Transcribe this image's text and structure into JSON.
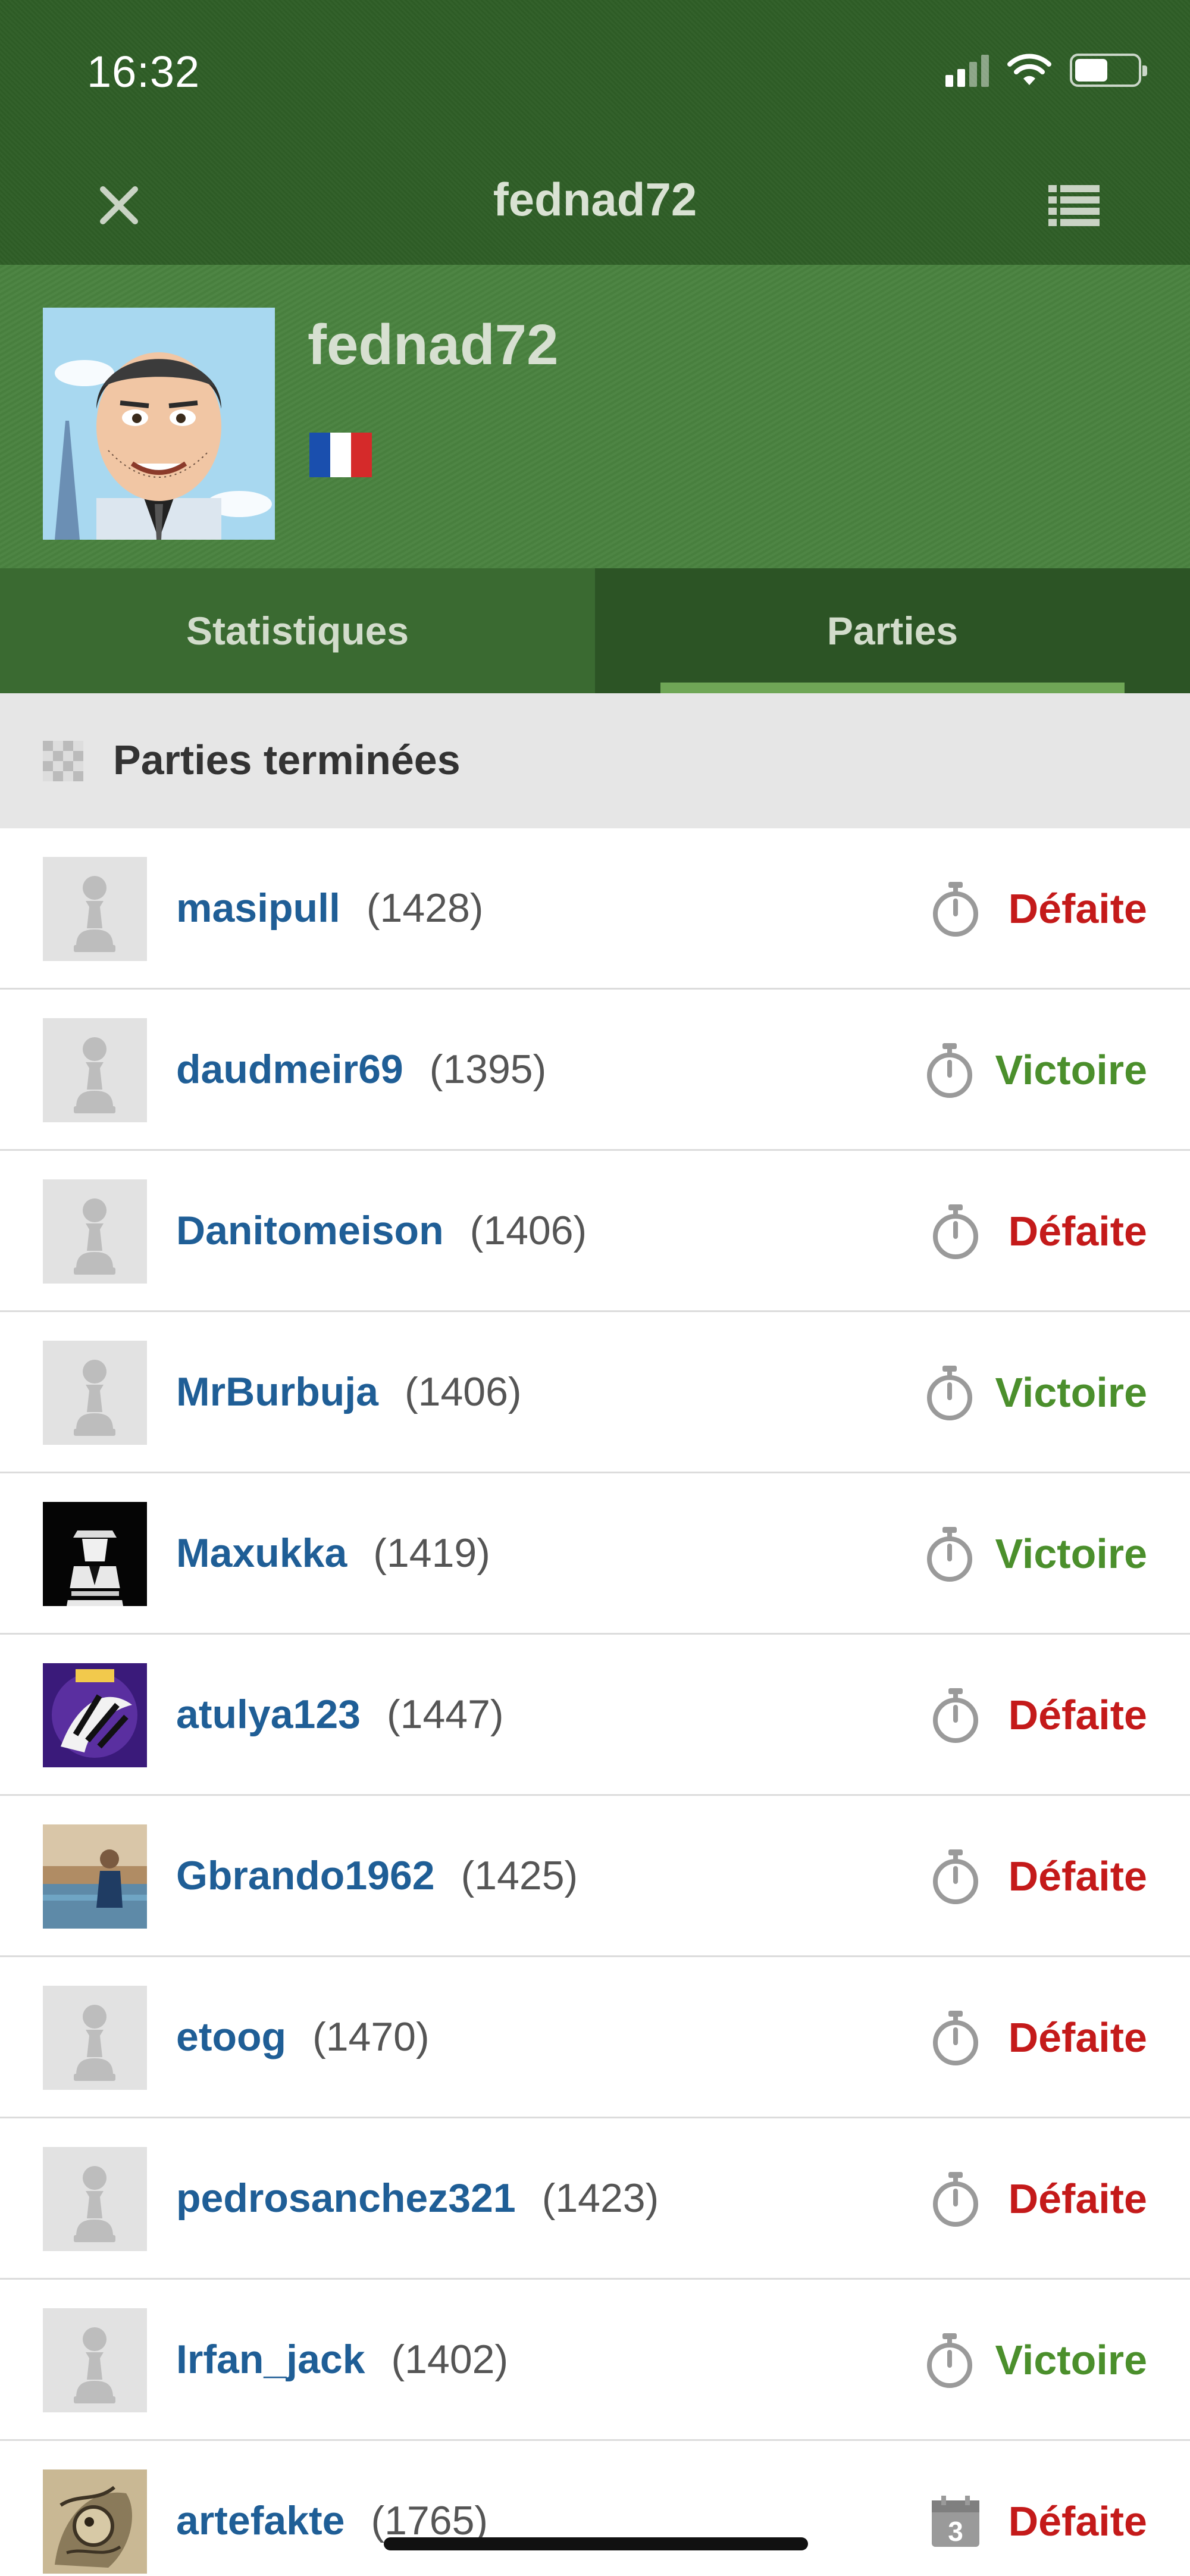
{
  "status_bar": {
    "time": "16:32"
  },
  "nav": {
    "title": "fednad72"
  },
  "profile": {
    "username": "fednad72",
    "country": "France",
    "flag_colors": [
      "#1a4fae",
      "#ffffff",
      "#d52a2a"
    ]
  },
  "tabs": [
    {
      "label": "Statistiques",
      "selected": false
    },
    {
      "label": "Parties",
      "selected": true
    }
  ],
  "section": {
    "title": "Parties terminées"
  },
  "games": [
    {
      "opponent": "masipull",
      "rating": "(1428)",
      "result": "Défaite",
      "outcome": "loss",
      "avatar": "pawn",
      "mode_icon": "stopwatch-icon"
    },
    {
      "opponent": "daudmeir69",
      "rating": "(1395)",
      "result": "Victoire",
      "outcome": "win",
      "avatar": "pawn",
      "mode_icon": "stopwatch-icon"
    },
    {
      "opponent": "Danitomeison",
      "rating": "(1406)",
      "result": "Défaite",
      "outcome": "loss",
      "avatar": "pawn",
      "mode_icon": "stopwatch-icon"
    },
    {
      "opponent": "MrBurbuja",
      "rating": "(1406)",
      "result": "Victoire",
      "outcome": "win",
      "avatar": "pawn",
      "mode_icon": "stopwatch-icon"
    },
    {
      "opponent": "Maxukka",
      "rating": "(1419)",
      "result": "Victoire",
      "outcome": "win",
      "avatar": "godfather",
      "mode_icon": "stopwatch-icon"
    },
    {
      "opponent": "atulya123",
      "rating": "(1447)",
      "result": "Défaite",
      "outcome": "loss",
      "avatar": "purple",
      "mode_icon": "stopwatch-icon"
    },
    {
      "opponent": "Gbrando1962",
      "rating": "(1425)",
      "result": "Défaite",
      "outcome": "loss",
      "avatar": "photo",
      "mode_icon": "stopwatch-icon"
    },
    {
      "opponent": "etoog",
      "rating": "(1470)",
      "result": "Défaite",
      "outcome": "loss",
      "avatar": "pawn",
      "mode_icon": "stopwatch-icon"
    },
    {
      "opponent": "pedrosanchez321",
      "rating": "(1423)",
      "result": "Défaite",
      "outcome": "loss",
      "avatar": "pawn",
      "mode_icon": "stopwatch-icon"
    },
    {
      "opponent": "Irfan_jack",
      "rating": "(1402)",
      "result": "Victoire",
      "outcome": "win",
      "avatar": "pawn",
      "mode_icon": "stopwatch-icon"
    },
    {
      "opponent": "artefakte",
      "rating": "(1765)",
      "result": "Défaite",
      "outcome": "loss",
      "avatar": "sketch",
      "mode_icon": "calendar-icon",
      "calendar_day": "3"
    }
  ],
  "colors": {
    "header_green": "#2f5e27",
    "profile_green": "#4a8240",
    "link_blue": "#1f5e96",
    "loss_red": "#c41a1a",
    "win_green": "#4b8f2c"
  }
}
